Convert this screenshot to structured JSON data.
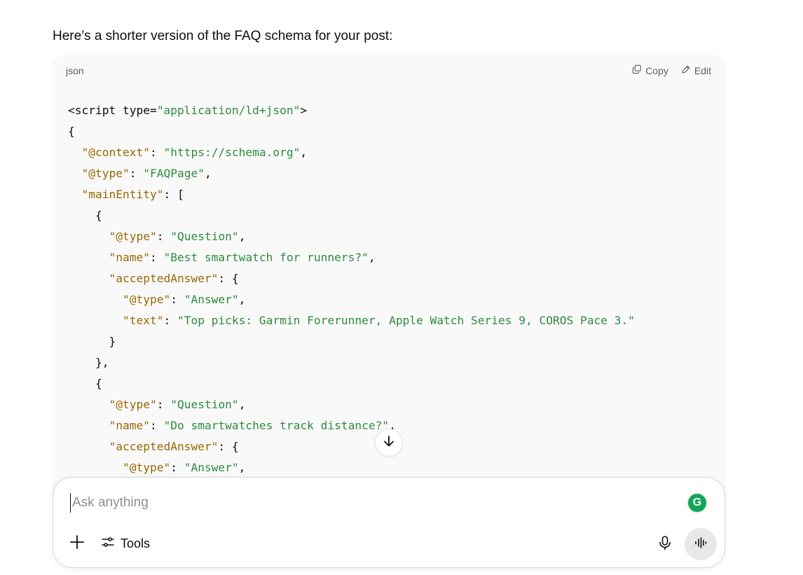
{
  "intro_text": "Here’s a shorter version of the FAQ schema for your post:",
  "code_block": {
    "language": "json",
    "copy_label": "Copy",
    "edit_label": "Edit",
    "lines": [
      [
        {
          "t": "p",
          "v": "<script type="
        },
        {
          "t": "s",
          "v": "\"application/ld+json\""
        },
        {
          "t": "p",
          "v": ">"
        }
      ],
      [
        {
          "t": "p",
          "v": "{"
        }
      ],
      [
        {
          "t": "p",
          "v": "  "
        },
        {
          "t": "k",
          "v": "\"@context\""
        },
        {
          "t": "p",
          "v": ": "
        },
        {
          "t": "s",
          "v": "\"https://schema.org\""
        },
        {
          "t": "p",
          "v": ","
        }
      ],
      [
        {
          "t": "p",
          "v": "  "
        },
        {
          "t": "k",
          "v": "\"@type\""
        },
        {
          "t": "p",
          "v": ": "
        },
        {
          "t": "s",
          "v": "\"FAQPage\""
        },
        {
          "t": "p",
          "v": ","
        }
      ],
      [
        {
          "t": "p",
          "v": "  "
        },
        {
          "t": "k",
          "v": "\"mainEntity\""
        },
        {
          "t": "p",
          "v": ": ["
        }
      ],
      [
        {
          "t": "p",
          "v": "    {"
        }
      ],
      [
        {
          "t": "p",
          "v": "      "
        },
        {
          "t": "k",
          "v": "\"@type\""
        },
        {
          "t": "p",
          "v": ": "
        },
        {
          "t": "s",
          "v": "\"Question\""
        },
        {
          "t": "p",
          "v": ","
        }
      ],
      [
        {
          "t": "p",
          "v": "      "
        },
        {
          "t": "k",
          "v": "\"name\""
        },
        {
          "t": "p",
          "v": ": "
        },
        {
          "t": "s",
          "v": "\"Best smartwatch for runners?\""
        },
        {
          "t": "p",
          "v": ","
        }
      ],
      [
        {
          "t": "p",
          "v": "      "
        },
        {
          "t": "k",
          "v": "\"acceptedAnswer\""
        },
        {
          "t": "p",
          "v": ": {"
        }
      ],
      [
        {
          "t": "p",
          "v": "        "
        },
        {
          "t": "k",
          "v": "\"@type\""
        },
        {
          "t": "p",
          "v": ": "
        },
        {
          "t": "s",
          "v": "\"Answer\""
        },
        {
          "t": "p",
          "v": ","
        }
      ],
      [
        {
          "t": "p",
          "v": "        "
        },
        {
          "t": "k",
          "v": "\"text\""
        },
        {
          "t": "p",
          "v": ": "
        },
        {
          "t": "s",
          "v": "\"Top picks: Garmin Forerunner, Apple Watch Series 9, COROS Pace 3.\""
        }
      ],
      [
        {
          "t": "p",
          "v": "      }"
        }
      ],
      [
        {
          "t": "p",
          "v": "    },"
        }
      ],
      [
        {
          "t": "p",
          "v": "    {"
        }
      ],
      [
        {
          "t": "p",
          "v": "      "
        },
        {
          "t": "k",
          "v": "\"@type\""
        },
        {
          "t": "p",
          "v": ": "
        },
        {
          "t": "s",
          "v": "\"Question\""
        },
        {
          "t": "p",
          "v": ","
        }
      ],
      [
        {
          "t": "p",
          "v": "      "
        },
        {
          "t": "k",
          "v": "\"name\""
        },
        {
          "t": "p",
          "v": ": "
        },
        {
          "t": "s",
          "v": "\"Do smartwatches track distance?\""
        },
        {
          "t": "p",
          "v": ","
        }
      ],
      [
        {
          "t": "p",
          "v": "      "
        },
        {
          "t": "k",
          "v": "\"acceptedAnswer\""
        },
        {
          "t": "p",
          "v": ": {"
        }
      ],
      [
        {
          "t": "p",
          "v": "        "
        },
        {
          "t": "k",
          "v": "\"@type\""
        },
        {
          "t": "p",
          "v": ": "
        },
        {
          "t": "s",
          "v": "\"Answer\""
        },
        {
          "t": "p",
          "v": ","
        }
      ]
    ]
  },
  "composer": {
    "placeholder": "Ask anything",
    "tools_label": "Tools",
    "grammarly_letter": "G"
  },
  "icons": {
    "copy": "copy-icon",
    "edit": "edit-pencil-icon",
    "scroll": "arrow-down-icon",
    "plus": "plus-icon",
    "tools": "sliders-icon",
    "mic": "microphone-icon",
    "voice": "voice-waveform-icon",
    "grammarly": "grammarly-icon"
  },
  "colors": {
    "key": "#9a6700",
    "string": "#2e8b3e",
    "code_bg": "#f9f9f9",
    "grammarly": "#15a35a"
  }
}
